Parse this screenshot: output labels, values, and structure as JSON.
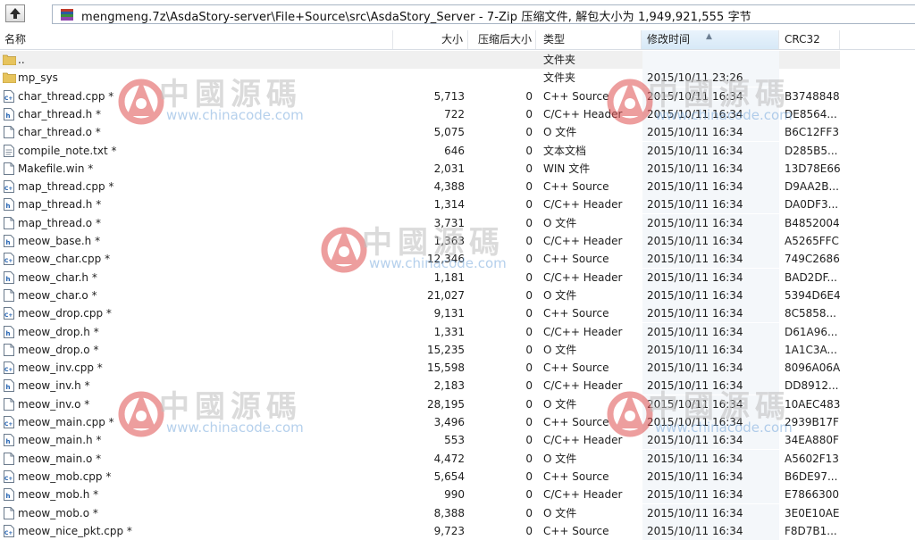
{
  "address_bar": {
    "path": "mengmeng.7z\\AsdaStory-server\\File+Source\\src\\AsdaStory_Server - 7-Zip 压缩文件, 解包大小为 1,949,921,555 字节"
  },
  "columns": {
    "name": "名称",
    "size": "大小",
    "packed": "压缩后大小",
    "type": "类型",
    "modified": "修改时间",
    "crc": "CRC32"
  },
  "files": [
    {
      "name": "..",
      "size": "",
      "packed": "",
      "type": "文件夹",
      "modified": "",
      "crc": "",
      "icon": "folder-icon"
    },
    {
      "name": "mp_sys",
      "size": "",
      "packed": "",
      "type": "文件夹",
      "modified": "2015/10/11 23:26",
      "crc": "",
      "icon": "folder-icon"
    },
    {
      "name": "char_thread.cpp *",
      "size": "5,713",
      "packed": "0",
      "type": "C++ Source",
      "modified": "2015/10/11 16:34",
      "crc": "B3748848",
      "icon": "cpp-file-icon"
    },
    {
      "name": "char_thread.h *",
      "size": "722",
      "packed": "0",
      "type": "C/C++ Header",
      "modified": "2015/10/11 16:34",
      "crc": "DE8564...",
      "icon": "header-file-icon"
    },
    {
      "name": "char_thread.o *",
      "size": "5,075",
      "packed": "0",
      "type": "O 文件",
      "modified": "2015/10/11 16:34",
      "crc": "B6C12FF3",
      "icon": "generic-file-icon"
    },
    {
      "name": "compile_note.txt *",
      "size": "646",
      "packed": "0",
      "type": "文本文档",
      "modified": "2015/10/11 16:34",
      "crc": "D285B5...",
      "icon": "text-file-icon"
    },
    {
      "name": "Makefile.win *",
      "size": "2,031",
      "packed": "0",
      "type": "WIN 文件",
      "modified": "2015/10/11 16:34",
      "crc": "13D78E66",
      "icon": "generic-file-icon"
    },
    {
      "name": "map_thread.cpp *",
      "size": "4,388",
      "packed": "0",
      "type": "C++ Source",
      "modified": "2015/10/11 16:34",
      "crc": "D9AA2B...",
      "icon": "cpp-file-icon"
    },
    {
      "name": "map_thread.h *",
      "size": "1,314",
      "packed": "0",
      "type": "C/C++ Header",
      "modified": "2015/10/11 16:34",
      "crc": "DA0DF3...",
      "icon": "header-file-icon"
    },
    {
      "name": "map_thread.o *",
      "size": "3,731",
      "packed": "0",
      "type": "O 文件",
      "modified": "2015/10/11 16:34",
      "crc": "B4852004",
      "icon": "generic-file-icon"
    },
    {
      "name": "meow_base.h *",
      "size": "1,363",
      "packed": "0",
      "type": "C/C++ Header",
      "modified": "2015/10/11 16:34",
      "crc": "A5265FFC",
      "icon": "header-file-icon"
    },
    {
      "name": "meow_char.cpp *",
      "size": "12,346",
      "packed": "0",
      "type": "C++ Source",
      "modified": "2015/10/11 16:34",
      "crc": "749C2686",
      "icon": "cpp-file-icon"
    },
    {
      "name": "meow_char.h *",
      "size": "1,181",
      "packed": "0",
      "type": "C/C++ Header",
      "modified": "2015/10/11 16:34",
      "crc": "BAD2DF...",
      "icon": "header-file-icon"
    },
    {
      "name": "meow_char.o *",
      "size": "21,027",
      "packed": "0",
      "type": "O 文件",
      "modified": "2015/10/11 16:34",
      "crc": "5394D6E4",
      "icon": "generic-file-icon"
    },
    {
      "name": "meow_drop.cpp *",
      "size": "9,131",
      "packed": "0",
      "type": "C++ Source",
      "modified": "2015/10/11 16:34",
      "crc": "8C5858...",
      "icon": "cpp-file-icon"
    },
    {
      "name": "meow_drop.h *",
      "size": "1,331",
      "packed": "0",
      "type": "C/C++ Header",
      "modified": "2015/10/11 16:34",
      "crc": "D61A96...",
      "icon": "header-file-icon"
    },
    {
      "name": "meow_drop.o *",
      "size": "15,235",
      "packed": "0",
      "type": "O 文件",
      "modified": "2015/10/11 16:34",
      "crc": "1A1C3A...",
      "icon": "generic-file-icon"
    },
    {
      "name": "meow_inv.cpp *",
      "size": "15,598",
      "packed": "0",
      "type": "C++ Source",
      "modified": "2015/10/11 16:34",
      "crc": "8096A06A",
      "icon": "cpp-file-icon"
    },
    {
      "name": "meow_inv.h *",
      "size": "2,183",
      "packed": "0",
      "type": "C/C++ Header",
      "modified": "2015/10/11 16:34",
      "crc": "DD8912...",
      "icon": "header-file-icon"
    },
    {
      "name": "meow_inv.o *",
      "size": "28,195",
      "packed": "0",
      "type": "O 文件",
      "modified": "2015/10/11 16:34",
      "crc": "10AEC483",
      "icon": "generic-file-icon"
    },
    {
      "name": "meow_main.cpp *",
      "size": "3,496",
      "packed": "0",
      "type": "C++ Source",
      "modified": "2015/10/11 16:34",
      "crc": "2939B17F",
      "icon": "cpp-file-icon"
    },
    {
      "name": "meow_main.h *",
      "size": "553",
      "packed": "0",
      "type": "C/C++ Header",
      "modified": "2015/10/11 16:34",
      "crc": "34EA880F",
      "icon": "header-file-icon"
    },
    {
      "name": "meow_main.o *",
      "size": "4,472",
      "packed": "0",
      "type": "O 文件",
      "modified": "2015/10/11 16:34",
      "crc": "A5602F13",
      "icon": "generic-file-icon"
    },
    {
      "name": "meow_mob.cpp *",
      "size": "5,654",
      "packed": "0",
      "type": "C++ Source",
      "modified": "2015/10/11 16:34",
      "crc": "B6DE97...",
      "icon": "cpp-file-icon"
    },
    {
      "name": "meow_mob.h *",
      "size": "990",
      "packed": "0",
      "type": "C/C++ Header",
      "modified": "2015/10/11 16:34",
      "crc": "E7866300",
      "icon": "header-file-icon"
    },
    {
      "name": "meow_mob.o *",
      "size": "8,388",
      "packed": "0",
      "type": "O 文件",
      "modified": "2015/10/11 16:34",
      "crc": "3E0E10AE",
      "icon": "generic-file-icon"
    },
    {
      "name": "meow_nice_pkt.cpp *",
      "size": "9,723",
      "packed": "0",
      "type": "C++ Source",
      "modified": "2015/10/11 16:34",
      "crc": "F8D7B1...",
      "icon": "cpp-file-icon"
    }
  ],
  "watermark": {
    "text": "中國源碼",
    "url": "www.chinacode.com"
  }
}
